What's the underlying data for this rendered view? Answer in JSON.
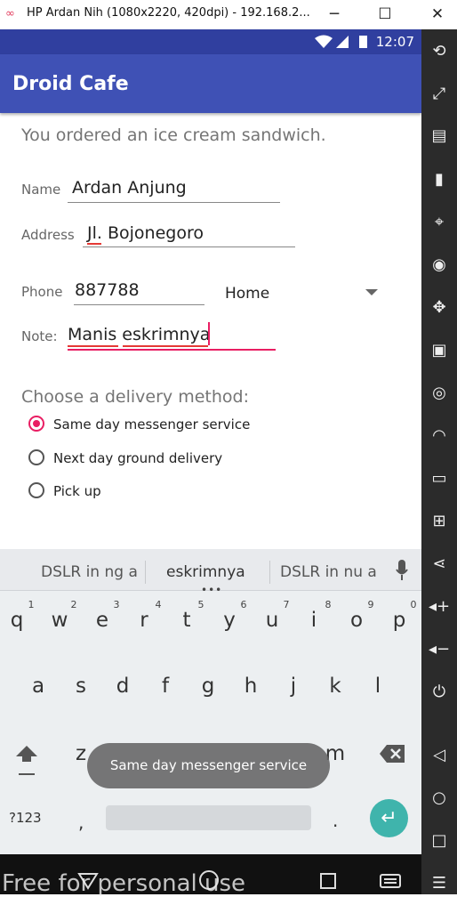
{
  "window": {
    "title": "HP Ardan Nih (1080x2220, 420dpi) - 192.168.2...",
    "minimize": "─",
    "maximize": "☐",
    "close": "✕",
    "app_icon": "∞"
  },
  "status_bar": {
    "time": "12:07"
  },
  "app_bar": {
    "title": "Droid Cafe"
  },
  "order": {
    "message": "You ordered an ice cream sandwich.",
    "name_label": "Name",
    "name_value": "Ardan Anjung",
    "address_label": "Address",
    "address_value": "Jl. Bojonegoro",
    "phone_label": "Phone",
    "phone_value": "887788",
    "phone_type": "Home",
    "note_label": "Note:",
    "note_value": "Manis eskrimnya"
  },
  "delivery": {
    "heading": "Choose a delivery method:",
    "options": [
      {
        "label": "Same day messenger service",
        "selected": true
      },
      {
        "label": "Next day ground delivery",
        "selected": false
      },
      {
        "label": "Pick up",
        "selected": false
      }
    ]
  },
  "keyboard": {
    "suggestions": [
      "DSLR in ng a",
      "eskrimnya",
      "DSLR in nu a"
    ],
    "row1": [
      "q",
      "w",
      "e",
      "r",
      "t",
      "y",
      "u",
      "i",
      "o",
      "p"
    ],
    "row1_numbers": [
      "1",
      "2",
      "3",
      "4",
      "5",
      "6",
      "7",
      "8",
      "9",
      "0"
    ],
    "row2": [
      "a",
      "s",
      "d",
      "f",
      "g",
      "h",
      "j",
      "k",
      "l"
    ],
    "row3_visible": [
      "z",
      "m"
    ],
    "symbols_key": "?123",
    "comma": ",",
    "period": "."
  },
  "toast": {
    "text": "Same day messenger service"
  },
  "watermark": "Free for personal use",
  "colors": {
    "primary": "#3f51b5",
    "primary_dark": "#303f9f",
    "accent": "#e91e63",
    "enter_key": "#3fb4ac"
  }
}
